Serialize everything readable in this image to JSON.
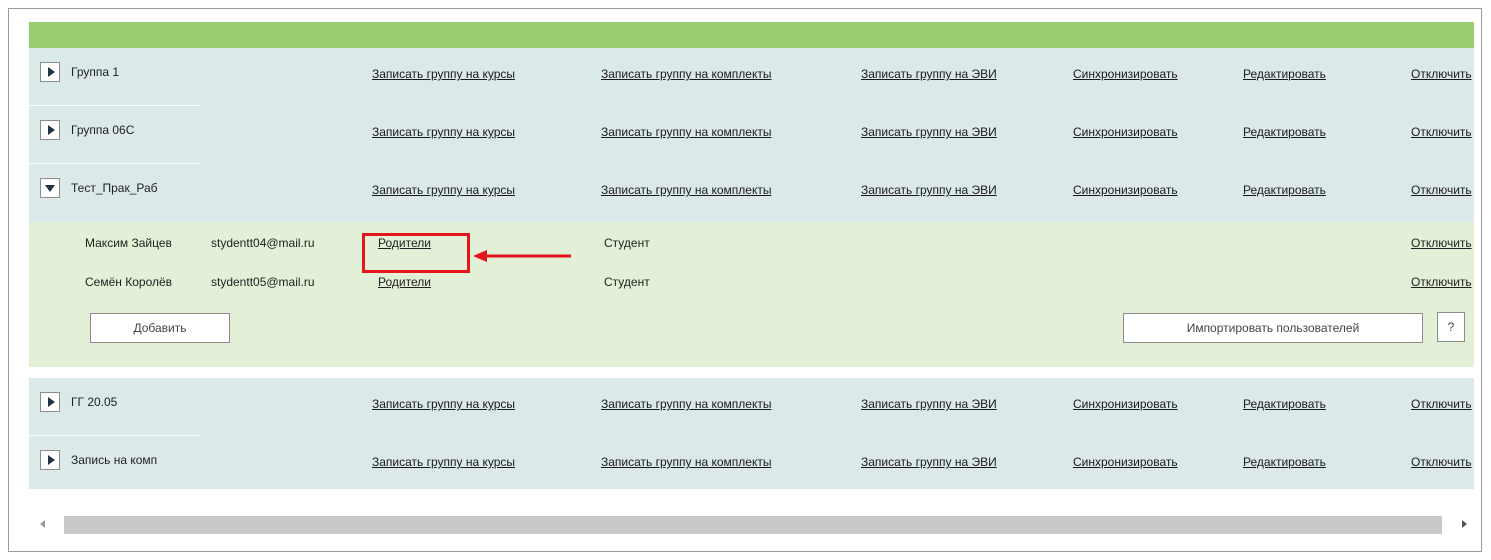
{
  "groups_top": [
    {
      "name": "Группа 1"
    },
    {
      "name": "Группа 06С"
    },
    {
      "name": "Тест_Прак_Раб"
    }
  ],
  "groups_bottom": [
    {
      "name": "ГГ 20.05"
    },
    {
      "name": "Запись на комп"
    }
  ],
  "actions": {
    "enroll_courses": "Записать группу на курсы",
    "enroll_sets": "Записать группу на комплекты",
    "enroll_evi": "Записать группу на ЭВИ",
    "sync": "Синхронизировать",
    "edit": "Редактировать",
    "disable": "Отключить"
  },
  "members": [
    {
      "name": "Максим Зайцев",
      "email": "stydentt04@mail.ru",
      "parents": "Родители",
      "role": "Студент",
      "disable": "Отключить"
    },
    {
      "name": "Семён Королёв",
      "email": "stydentt05@mail.ru",
      "parents": "Родители",
      "role": "Студент",
      "disable": "Отключить"
    }
  ],
  "buttons": {
    "add": "Добавить",
    "import_users": "Импортировать пользователей",
    "help": "?"
  },
  "colors": {
    "header_green": "#98cd6e",
    "group_row": "#dce9e9",
    "members_bg": "#e1f0d6",
    "highlight": "#e3171b"
  }
}
